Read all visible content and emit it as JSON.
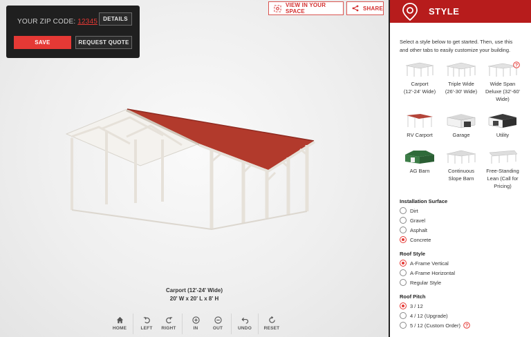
{
  "zip": {
    "label": "YOUR ZIP CODE:",
    "code": "12345"
  },
  "buttons": {
    "details": "DETAILS",
    "save": "SAVE",
    "request_quote": "REQUEST QUOTE",
    "view_in_space": "VIEW IN YOUR SPACE",
    "share": "SHARE"
  },
  "caption": {
    "title": "Carport (12'-24' Wide)",
    "dims": "20' W x 20' L x 8' H"
  },
  "toolbar": [
    {
      "label": "HOME",
      "icon": "home-icon"
    },
    {
      "label": "LEFT",
      "icon": "rotate-left-icon"
    },
    {
      "label": "RIGHT",
      "icon": "rotate-right-icon"
    },
    {
      "label": "IN",
      "icon": "zoom-in-icon"
    },
    {
      "label": "OUT",
      "icon": "zoom-out-icon"
    },
    {
      "label": "UNDO",
      "icon": "undo-icon"
    },
    {
      "label": "RESET",
      "icon": "reset-icon"
    }
  ],
  "sidebar": {
    "title": "STYLE",
    "intro": "Select a style below to get started. Then, use this and other tabs to easily customize your building.",
    "styles": [
      {
        "name": "Carport\n(12'-24' Wide)",
        "help": false
      },
      {
        "name": "Triple Wide\n(26'-30' Wide)",
        "help": false
      },
      {
        "name": "Wide Span\nDeluxe (32'-60'\nWide)",
        "help": true
      },
      {
        "name": "RV Carport",
        "help": false
      },
      {
        "name": "Garage",
        "help": false
      },
      {
        "name": "Utility",
        "help": false
      },
      {
        "name": "AG Barn",
        "help": false
      },
      {
        "name": "Continuous\nSlope Barn",
        "help": false
      },
      {
        "name": "Free-Standing\nLean (Call for\nPricing)",
        "help": false
      }
    ],
    "installation_surface": {
      "title": "Installation Surface",
      "options": [
        "Dirt",
        "Gravel",
        "Asphalt",
        "Concrete"
      ],
      "selected": "Concrete"
    },
    "roof_style": {
      "title": "Roof Style",
      "options": [
        "A-Frame Vertical",
        "A-Frame Horizontal",
        "Regular Style"
      ],
      "selected": "A-Frame Vertical"
    },
    "roof_pitch": {
      "title": "Roof Pitch",
      "options": [
        "3 / 12",
        "4 / 12 (Upgrade)",
        "5 / 12 (Custom Order)"
      ],
      "selected": "3 / 12"
    }
  },
  "colors": {
    "accent": "#e53935",
    "header": "#b71c1c",
    "roof": "#b23a2c",
    "frame": "#e8e3dc"
  }
}
